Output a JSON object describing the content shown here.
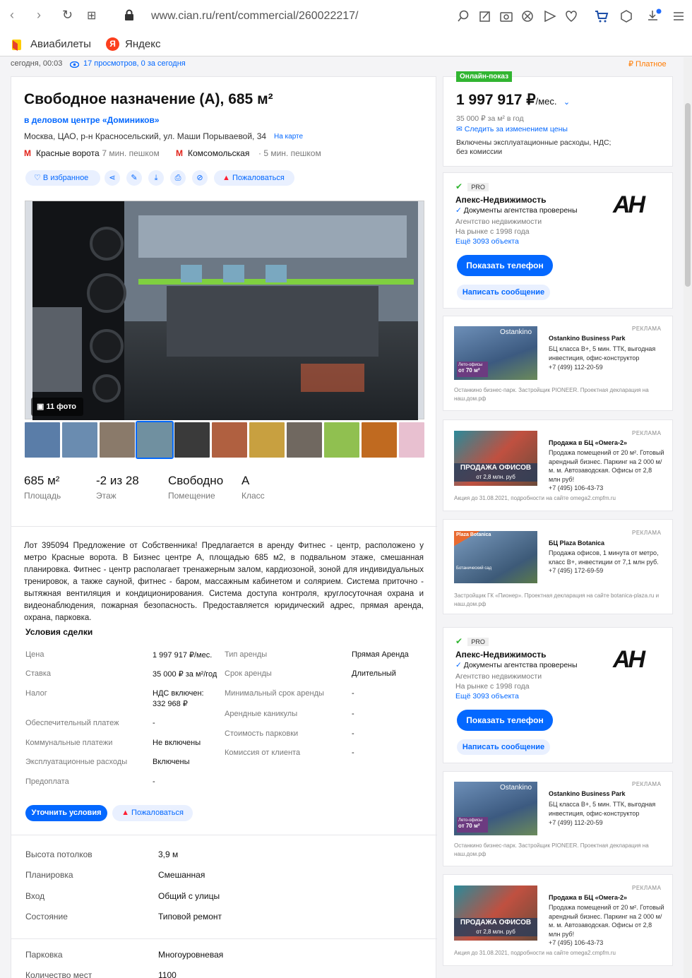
{
  "browser": {
    "url": "www.cian.ru/rent/commercial/260022217/",
    "back": "‹",
    "forward": "›",
    "reload": "↻",
    "apps": "⊞"
  },
  "bookmarks": [
    {
      "label": "Авиабилеты"
    },
    {
      "label": "Яндекс"
    }
  ],
  "meta": {
    "date": "сегодня, 00:03",
    "views": "17 просмотров, 0 за сегодня",
    "paid": "₽ Платное"
  },
  "offer": {
    "title": "Свободное назначение (А), 685 м²",
    "bc": "в деловом центре «Домиников»",
    "address": "Москва, ЦАО, р-н Красносельский, ул. Маши Порываевой, 34",
    "map_link": "На карте",
    "metro": [
      {
        "name": "Красные ворота",
        "time": "· 7 мин. пешком"
      },
      {
        "name": "Комсомольская",
        "time": "· 5 мин. пешком"
      }
    ],
    "actions": {
      "favorite": "В избранное",
      "complain": "Пожаловаться"
    },
    "photo_count": "11 фото",
    "stats": [
      {
        "value": "685 м²",
        "label": "Площадь"
      },
      {
        "value": "-2 из 28",
        "label": "Этаж"
      },
      {
        "value": "Свободно",
        "label": "Помещение"
      },
      {
        "value": "А",
        "label": "Класс"
      }
    ],
    "description": "Лот 395094 Предложение от Собственника! Предлагается в аренду Фитнес - центр, расположено у метро Красные ворота. В Бизнес центре А, площадью 685 м2, в подвальном этаже, смешанная планировка. Фитнес - центр располагает тренажерным залом, кардиозоной, зоной для индивидуальных тренировок, а также сауной, фитнес - баром, массажным кабинетом и солярием. Система приточно - вытяжная вентиляция и кондиционирования. Система доступа контроля, круглосуточная охрана и видеонаблюдения, пожарная безопасность. Предоставляется юридический адрес, прямая аренда, охрана, парковка.",
    "terms_title": "Условия сделки",
    "terms_left": [
      {
        "label": "Цена",
        "value": "1 997 917 ₽/мес."
      },
      {
        "label": "Ставка",
        "value": "35 000 ₽ за м²/год"
      },
      {
        "label": "Налог",
        "value": "НДС включен:",
        "value2": "332 968 ₽"
      },
      {
        "label": "Обеспечительный платеж",
        "value": "-"
      },
      {
        "label": "Коммунальные платежи",
        "value": "Не включены"
      },
      {
        "label": "Эксплуатационные расходы",
        "value": "Включены"
      },
      {
        "label": "Предоплата",
        "value": "-"
      }
    ],
    "terms_right": [
      {
        "label": "Тип аренды",
        "value": "Прямая Аренда"
      },
      {
        "label": "Срок аренды",
        "value": "Длительный"
      },
      {
        "label": "Минимальный срок аренды",
        "value": "-"
      },
      {
        "label": "Арендные каникулы",
        "value": "-"
      },
      {
        "label": "Стоимость парковки",
        "value": "-"
      },
      {
        "label": "Комиссия от клиента",
        "value": "-"
      }
    ],
    "clarify": "Уточнить условия",
    "complain2": "Пожаловаться",
    "features": [
      {
        "label": "Высота потолков",
        "value": "3,9 м"
      },
      {
        "label": "Планировка",
        "value": "Смешанная"
      },
      {
        "label": "Вход",
        "value": "Общий с улицы"
      },
      {
        "label": "Состояние",
        "value": "Типовой ремонт"
      }
    ],
    "parking": [
      {
        "label": "Парковка",
        "value": "Многоуровневая"
      },
      {
        "label": "Количество мест",
        "value": "1100"
      }
    ]
  },
  "price": {
    "badge": "Онлайн-показ",
    "main": "1 997 917 ₽",
    "per": "/мес.",
    "rate": "35 000 ₽ за м² в год",
    "track": "Следить за изменением цены",
    "incl": "Включены эксплуатационные расходы, НДС;",
    "incl2": "без комиссии"
  },
  "agent": {
    "pro": "PRO",
    "name": "Апекс-Недвижимость",
    "verified": "Документы агентства проверены",
    "type": "Агентство недвижимости",
    "since": "На рынке с 1998 года",
    "more": "Ещё 3093 объекта",
    "phone": "Показать телефон",
    "msg": "Написать сообщение",
    "logo": "АН"
  },
  "ads": [
    {
      "label": "РЕКЛАМА",
      "title": "Ostankino Business Park",
      "text": "БЦ класса В+, 5 мин. ТТК, выгодная инвестиция, офис-конструктор",
      "phone": "+7 (499) 112-20-59",
      "foot": "Останкино бизнес-парк. Застройщик PIONEER. Проектная декларация на наш.дом.рф",
      "img_a": "Ostankino",
      "img_b": "Лето-офисы",
      "img_c": "от 70 м²"
    },
    {
      "label": "РЕКЛАМА",
      "title": "Продажа в БЦ «Омега-2»",
      "text": "Продажа помещений от 20 м². Готовый арендный бизнес. Паркинг на 2 000 м/м. м. Автозаводская. Офисы от 2,8 млн руб!",
      "phone": "+7 (495) 106-43-73",
      "foot": "Акция до 31.08.2021, подробности на сайте omega2.cmpfm.ru",
      "img_a": "ПРОДАЖА ОФИСОВ",
      "img_b": "от 2,8 млн. руб"
    },
    {
      "label": "РЕКЛАМА",
      "title": "БЦ Plaza Botanica",
      "text": "Продажа офисов, 1 минута от метро, класс В+, инвестиции от 7,1 млн руб.",
      "phone": "+7 (495) 172-69-59",
      "foot": "Застройщик ГК «Пионер». Проектная декларация на сайте botanica-plaza.ru и наш.дом.рф",
      "img_a": "Plaza Botanica",
      "img_b": "Ботанический сад"
    }
  ],
  "colors": {
    "accent": "#0468ff",
    "green": "#31b531",
    "red": "#ff1f34",
    "orange": "#ff7a00"
  }
}
